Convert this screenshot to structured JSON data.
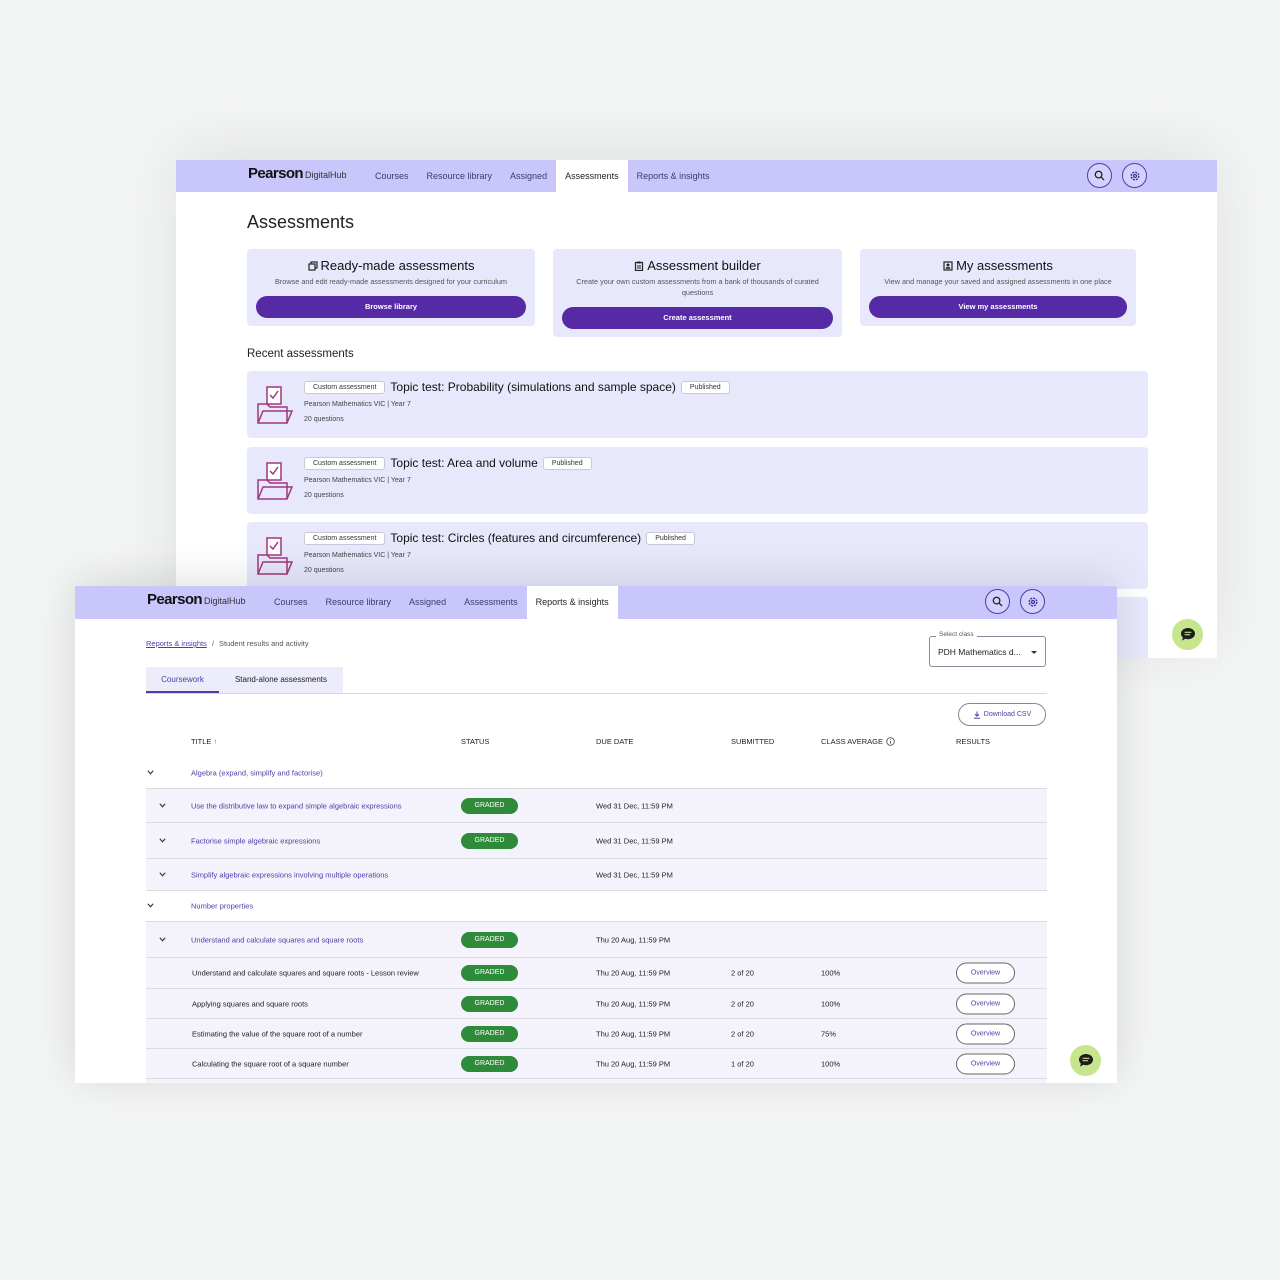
{
  "back": {
    "brand": {
      "main": "Pearson",
      "sub": "DigitalHub"
    },
    "nav": [
      {
        "label": "Courses",
        "active": false
      },
      {
        "label": "Resource library",
        "active": false
      },
      {
        "label": "Assigned",
        "active": false
      },
      {
        "label": "Assessments",
        "active": true
      },
      {
        "label": "Reports & insights",
        "active": false
      }
    ],
    "title": "Assessments",
    "cards": [
      {
        "title": "Ready-made assessments",
        "desc": "Browse and edit ready-made assessments designed for your curriculum",
        "button": "Browse library"
      },
      {
        "title": "Assessment builder",
        "desc": "Create your own custom assessments from a bank of thousands of curated questions",
        "button": "Create assessment"
      },
      {
        "title": "My assessments",
        "desc": "View and manage your saved and assigned assessments in one place",
        "button": "View my assessments"
      }
    ],
    "recent_title": "Recent assessments",
    "recent": [
      {
        "tag": "Custom assessment",
        "title": "Topic test: Probability (simulations and sample space)",
        "status": "Published",
        "course": "Pearson Mathematics VIC | Year 7",
        "questions": "20 questions"
      },
      {
        "tag": "Custom assessment",
        "title": "Topic test: Area and volume",
        "status": "Published",
        "course": "Pearson Mathematics VIC | Year 7",
        "questions": "20 questions"
      },
      {
        "tag": "Custom assessment",
        "title": "Topic test: Circles (features and circumference)",
        "status": "Published",
        "course": "Pearson Mathematics VIC | Year 7",
        "questions": "20 questions"
      }
    ]
  },
  "front": {
    "brand": {
      "main": "Pearson",
      "sub": "DigitalHub"
    },
    "nav": [
      {
        "label": "Courses",
        "active": false
      },
      {
        "label": "Resource library",
        "active": false
      },
      {
        "label": "Assigned",
        "active": false
      },
      {
        "label": "Assessments",
        "active": false
      },
      {
        "label": "Reports & insights",
        "active": true
      }
    ],
    "breadcrumb": {
      "link": "Reports & insights",
      "sep": "/",
      "current": "Student results and activity"
    },
    "select_class": {
      "label": "Select class",
      "value": "PDH Mathematics d..."
    },
    "tabs": [
      {
        "label": "Coursework",
        "active": true
      },
      {
        "label": "Stand-alone assessments",
        "active": false
      }
    ],
    "download": "Download CSV",
    "columns": {
      "title": "TITLE",
      "sort": "↑",
      "status": "STATUS",
      "due": "DUE DATE",
      "submitted": "SUBMITTED",
      "average": "CLASS AVERAGE",
      "results": "RESULTS"
    },
    "rows": [
      {
        "level": 0,
        "title": "Algebra (expand, simplify and factorise)"
      },
      {
        "level": 1,
        "title": "Use the distributive law to expand simple algebraic expressions",
        "status": "GRADED",
        "due": "Wed 31 Dec, 11:59 PM"
      },
      {
        "level": 1,
        "title": "Factorise simple algebraic expressions",
        "status": "GRADED",
        "due": "Wed 31 Dec, 11:59 PM"
      },
      {
        "level": 1,
        "title": "Simplify algebraic expressions involving multiple operations",
        "due": "Wed 31 Dec, 11:59 PM"
      },
      {
        "level": 0,
        "title": "Number properties"
      },
      {
        "level": 1,
        "title": "Understand and calculate squares and square roots",
        "status": "GRADED",
        "due": "Thu 20 Aug, 11:59 PM"
      },
      {
        "level": 2,
        "title": "Understand and calculate squares and square roots - Lesson review",
        "status": "GRADED",
        "due": "Thu 20 Aug, 11:59 PM",
        "submitted": "2 of 20",
        "average": "100%",
        "results": "Overview"
      },
      {
        "level": 2,
        "title": "Applying squares and square roots",
        "status": "GRADED",
        "due": "Thu 20 Aug, 11:59 PM",
        "submitted": "2 of 20",
        "average": "100%",
        "results": "Overview"
      },
      {
        "level": 2,
        "title": "Estimating the value of the square root of a number",
        "status": "GRADED",
        "due": "Thu 20 Aug, 11:59 PM",
        "submitted": "2 of 20",
        "average": "75%",
        "results": "Overview"
      },
      {
        "level": 2,
        "title": "Calculating the square root of a square number",
        "status": "GRADED",
        "due": "Thu 20 Aug, 11:59 PM",
        "submitted": "1 of 20",
        "average": "100%",
        "results": "Overview"
      }
    ]
  },
  "colors": {
    "nav_bg": "#c9c6fb",
    "accent": "#5629a5",
    "link": "#4b3fa8",
    "graded": "#2e8b3a",
    "chat": "#c7e58c",
    "card_bg": "#e8e8fd"
  }
}
